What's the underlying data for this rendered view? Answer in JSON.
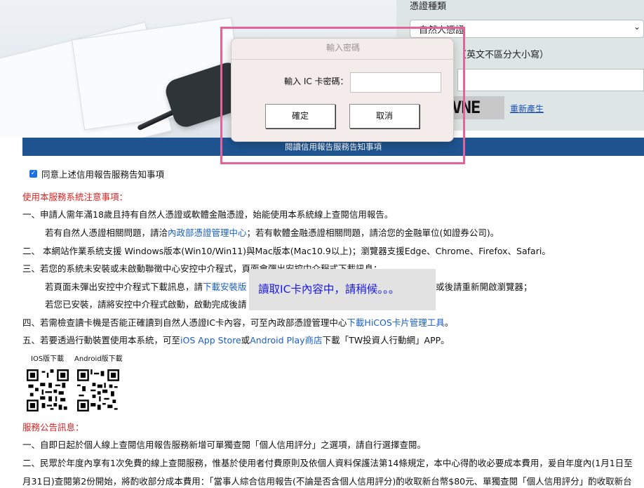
{
  "hero": {
    "image_name": "desk-documents-photo"
  },
  "right_panel": {
    "cert_type_label": "憑證種類",
    "cert_type_selected": "自然人憑證",
    "case_hint": "（英文不區分大小寫）",
    "captcha_text": "VNE",
    "regenerate_link": "重新產生"
  },
  "notice_bar": "閱讀信用報告服務告知事項",
  "agree": {
    "label": "同意上述信用報告服務告知事項",
    "checked": true
  },
  "service_notes": {
    "heading": "使用本服務系統注意事項：",
    "item1": "一、申請人需年滿18歲且持有自然人憑證或軟體金融憑證，始能使用本系統線上查閱信用報告。",
    "item1_sub_a": "若有自然人憑證相關問題，請洽",
    "item1_sub_link": "內政部憑證管理中心",
    "item1_sub_b": "；若有軟體金融憑證相關問題，請洽您的金融單位(如證券公司)。",
    "item2": "二、 本網站作業系統支援 Windows版本(Win10/Win11)與Mac版本(Mac10.9以上)；瀏覽器支援Edge、Chrome、Firefox、Safari。",
    "item3": "三、若您的系統未安裝或未啟動聯徵中心安控中介程式，頁面會彈出安控中介程式下載訊息：",
    "item3_sub1_a": "若頁面未彈出安控中介程式下載訊息，請",
    "item3_sub1_link": "下載安裝版",
    "item3_sub1_b": "或後請重新開啟瀏覽器；",
    "item3_sub2": "若您已安裝，請將安控中介程式啟動，啟動完成後請",
    "item4_a": "四、若需檢查讀卡機是否能正確讀到自然人憑證IC卡內容，可至內政部憑證管理中心",
    "item4_link": "下載HiCOS卡片管理工具",
    "item4_b": "。",
    "item5_a": "五、若要透過行動裝置使用本系統，可至",
    "item5_link1": "iOS App Store",
    "item5_mid": "或",
    "item5_link2": "Android Play商店",
    "item5_b": "下載「TW投資人行動網」APP。",
    "qr_ios_label": "IOS版下載",
    "qr_android_label": "Android版下載"
  },
  "announcements": {
    "heading": "服務公告訊息：",
    "item1": "一、自即日起於個人線上查閱信用報告服務新增可單獨查閱「個人信用評分」之選項，請自行選擇查閱。",
    "item2_line1": "二、民眾於年度內享有1次免費的線上查閱服務，惟基於使用者付費原則及依個人資料保護法第14條規定，本中心得酌收必要成本費用，爰自年度內(1月1日至",
    "item2_line2": "月31日)查閱第2份開始，將酌收部分成本費用：「當事人綜合信用報告(不論是否含個人信用評分)酌收取新台幣$80元、單獨查閱「個人信用評分」酌收取新台"
  },
  "toast": "讀取IC卡內容中，請稍候。。。",
  "dialog": {
    "title": "輸入密碼",
    "pin_label": "輸入 IC 卡密碼：",
    "pin_value": "",
    "ok_label": "確定",
    "cancel_label": "取消"
  }
}
